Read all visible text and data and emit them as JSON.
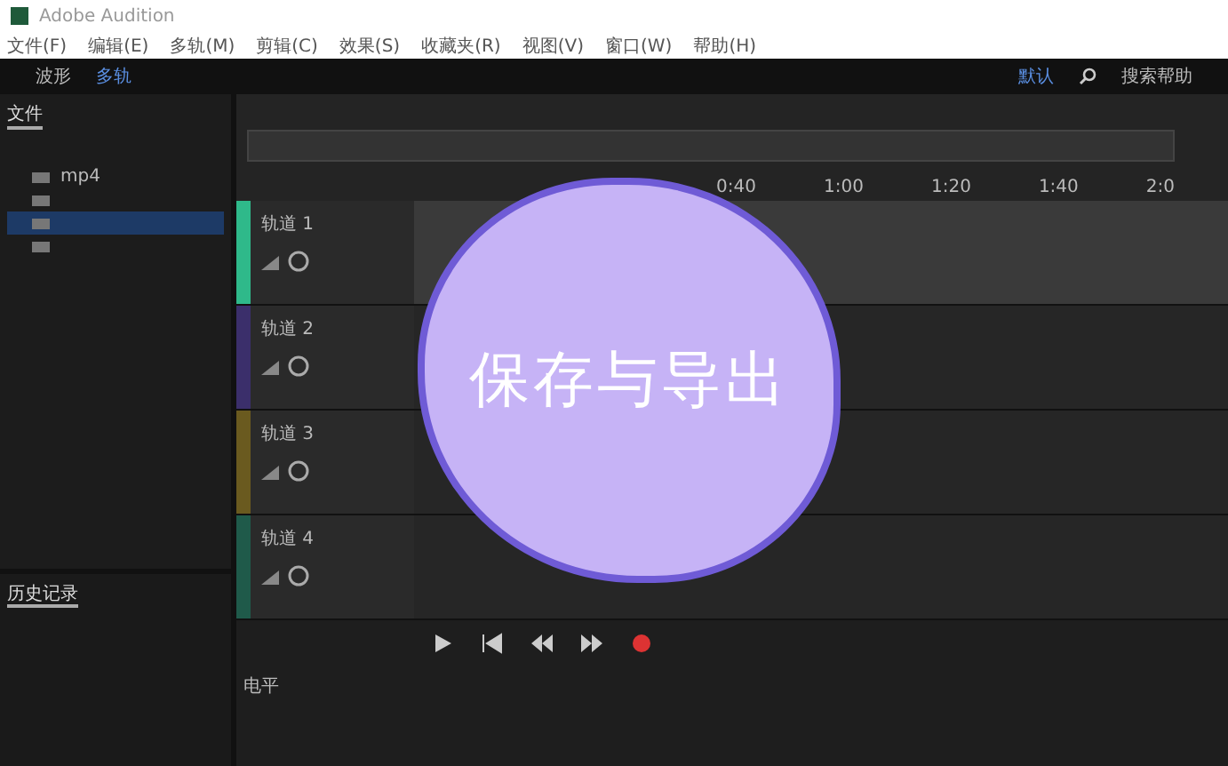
{
  "window": {
    "title": "Adobe Audition"
  },
  "menu": [
    "文件(F)",
    "编辑(E)",
    "多轨(M)",
    "剪辑(C)",
    "效果(S)",
    "收藏夹(R)",
    "视图(V)",
    "窗口(W)",
    "帮助(H)"
  ],
  "toolbar": {
    "modes": [
      {
        "label": "波形",
        "selected": false
      },
      {
        "label": "多轨",
        "selected": true
      }
    ],
    "workspace": "默认",
    "search": "搜索帮助"
  },
  "files_panel": {
    "tabs": [
      {
        "label": "文件",
        "selected": true
      }
    ],
    "items": [
      {
        "name": "mp4",
        "selected": false
      },
      {
        "selected": false
      },
      {
        "selected": true
      },
      {
        "selected": false
      }
    ]
  },
  "history_panel": {
    "title": "历史记录"
  },
  "ruler": [
    "0:40",
    "1:00",
    "1:20",
    "1:40",
    "2:0"
  ],
  "tracks": [
    {
      "name": "轨道 1",
      "color": "#2fb98a",
      "selected": true
    },
    {
      "name": "轨道 2",
      "color": "#3b2f6b",
      "selected": false
    },
    {
      "name": "轨道 3",
      "color": "#6a5a1f",
      "selected": false
    },
    {
      "name": "轨道 4",
      "color": "#1f5a4a",
      "selected": false
    }
  ],
  "levels_panel": {
    "title": "电平"
  },
  "sticker": {
    "text": "保存与导出"
  }
}
